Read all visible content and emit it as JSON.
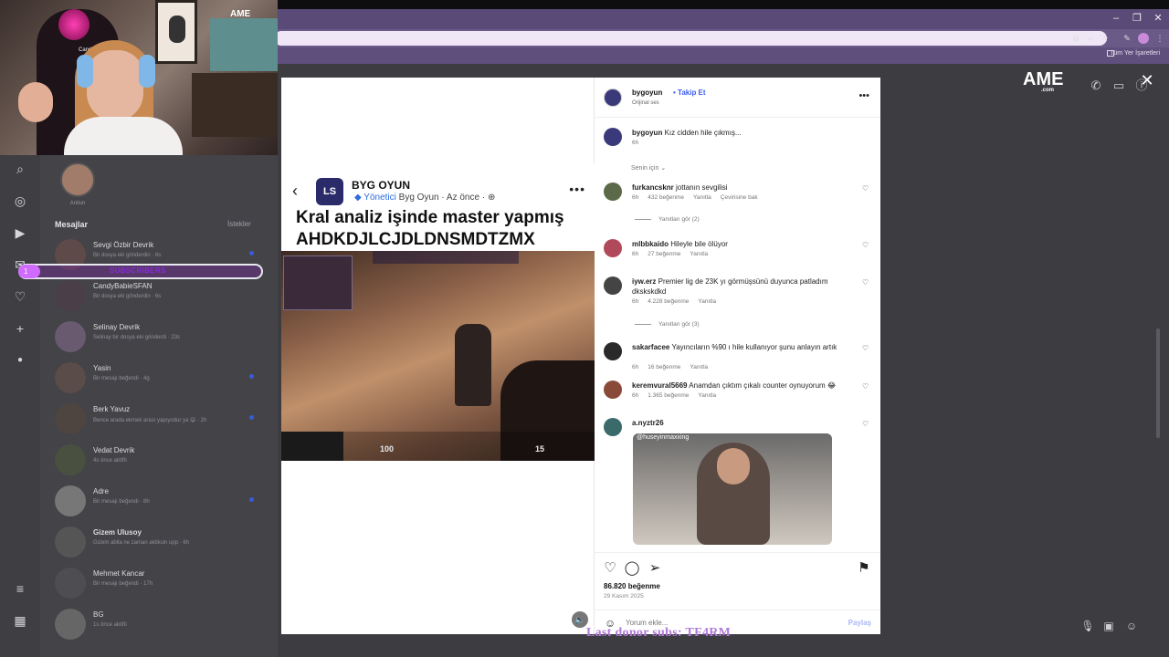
{
  "window": {
    "minimize": "–",
    "maximize": "❐",
    "close": "✕"
  },
  "bookmarks": {
    "all_bookmarks": "Tüm Yer İşaretleri"
  },
  "webcam": {
    "channel_name": "CandyBabie",
    "brand": "AME"
  },
  "sidebar": {
    "story_name": "Anilun",
    "messages_title": "Mesajlar",
    "requests_label": "İstekler",
    "conversations": [
      {
        "name": "Sevgi Özbir Devrik",
        "sub": "Bir dosya eki gönderdin · 6s",
        "bold": false,
        "unread": true
      },
      {
        "name": "CandyBabieSFAN",
        "sub": "Bir dosya eki gönderdin · 6s",
        "bold": false,
        "unread": false
      },
      {
        "name": "Selinay Devrik",
        "sub": "Selinay bir dosya eki gönderdi · 23s",
        "bold": false,
        "unread": false
      },
      {
        "name": "Yasin",
        "sub": "Bir mesajı beğendi · 4g",
        "bold": false,
        "unread": true
      },
      {
        "name": "Berk Yavuz",
        "sub": "Bence arada ekmek arası yapıyodur ya 😄 · 2h",
        "bold": false,
        "unread": true
      },
      {
        "name": "Vedat Devrik",
        "sub": "4s önce aktifti",
        "bold": false,
        "unread": false
      },
      {
        "name": "Adre",
        "sub": "Bir mesajı beğendi · 8h",
        "bold": false,
        "unread": true
      },
      {
        "name": "Gizem Ulusoy",
        "sub": "Gizem ablla ne zaman aktiksin upp · 6h",
        "bold": true,
        "unread": false
      },
      {
        "name": "Mehmet Kancar",
        "sub": "Bir mesajı beğendi · 17h",
        "bold": false,
        "unread": false
      },
      {
        "name": "BG",
        "sub": "1s önce aktifti",
        "bold": false,
        "unread": false
      }
    ],
    "sub_alert": {
      "count": "1",
      "text": "SUBSCRIBERS"
    }
  },
  "right_brand": {
    "name": "AME",
    "suffix": ".com"
  },
  "post": {
    "card_name": "BYG OYUN",
    "card_role": "Yönetici",
    "card_author": "Byg Oyun",
    "card_time": "Az önce",
    "headline_line1": "Kral analiz işinde master yapmış",
    "headline_line2": "AHDKDJLCJDLDNSMDTZMX",
    "hud_hp": "100",
    "hud_ammo": "15",
    "author": "bygoyun",
    "follow": "Takip Et",
    "audio": "Orijinal ses",
    "caption_user": "bygoyun",
    "caption_text": "Kız cidden hile çıkmış...",
    "caption_time": "6h",
    "for_you": "Senin için ⌄",
    "comments": [
      {
        "user": "furkancsknr",
        "text": "jottanın sevgilisi",
        "time": "6h",
        "likes": "432 beğenme",
        "reply": "Yanıtla",
        "extra": "Çevirisine bak",
        "replies": "Yanıtları gör (2)"
      },
      {
        "user": "mlbbkaido",
        "text": "Hileyle bile ölüyor",
        "time": "6h",
        "likes": "27 beğenme",
        "reply": "Yanıtla",
        "extra": "",
        "replies": ""
      },
      {
        "user": "iyw.erz",
        "text": "Premier lig de 23K yı görmüşsünü duyunca patladım dkskskdkd",
        "time": "6h",
        "likes": "4.228 beğenme",
        "reply": "Yanıtla",
        "extra": "",
        "replies": "Yanıtları gör (3)"
      },
      {
        "user": "sakarfacee",
        "text": "Yayıncıların %90 ı hile kullanıyor şunu anlayın artık",
        "time": "6h",
        "likes": "16 beğenme",
        "reply": "Yanıtla",
        "extra": "",
        "replies": ""
      },
      {
        "user": "keremvural5669",
        "text": "Anamdan çıktım çıkalı counter oynuyorum 😂",
        "time": "6h",
        "likes": "1.365 beğenme",
        "reply": "Yanıtla",
        "extra": "",
        "replies": ""
      },
      {
        "user": "a.nyztr26",
        "text": "",
        "time": "",
        "likes": "",
        "reply": "",
        "extra": "",
        "replies": ""
      }
    ],
    "gif_tag": "@huseyinmaxxing",
    "like_count": "86.820 beğenme",
    "date": "29 Kasım 2025",
    "comment_placeholder": "Yorum ekle...",
    "share": "Paylaş"
  },
  "overlay": {
    "last_donor": "Last donor subs: TF4RM"
  }
}
